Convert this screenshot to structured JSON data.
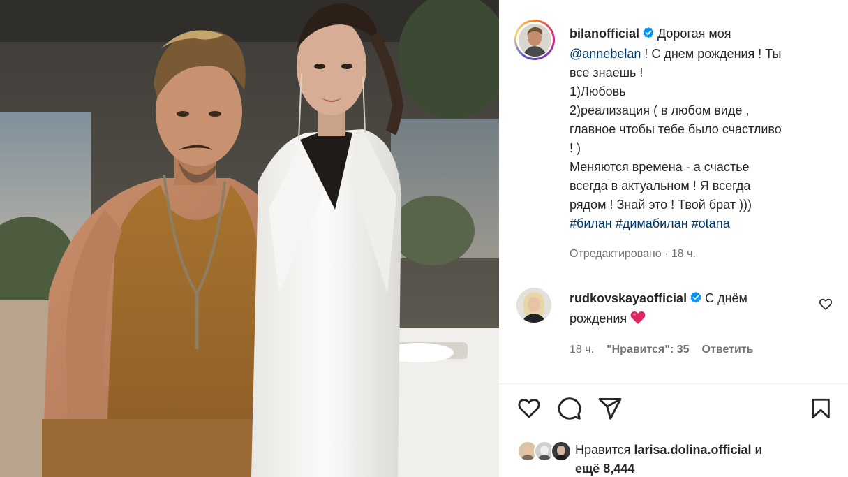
{
  "post": {
    "author": "bilanofficial",
    "caption_lines": [
      "Дорогая моя",
      "@annebelan",
      " ! С днем рождения ! Ты",
      "все знаешь !",
      "1)Любовь",
      "2)реализация ( в любом виде ,",
      "главное чтобы тебе было счастливо",
      "! )",
      "Меняются времена - а счастье",
      "всегда в актуальном ! Я всегда",
      "рядом ! Знай это ! Твой брат )))"
    ],
    "hashtags": [
      "#билан",
      "#димабилан",
      "#otana"
    ],
    "edited_label": "Отредактировано",
    "time": "18 ч."
  },
  "comment": {
    "author": "rudkovskayaofficial",
    "text_line1": "С днём",
    "text_line2": "рождения",
    "emoji": "❤️",
    "time": "18 ч.",
    "likes_label": "\"Нравится\": 35",
    "reply_label": "Ответить"
  },
  "likes": {
    "prefix": "Нравится",
    "user": "larisa.dolina.official",
    "suffix": "и",
    "rest": "ещё 8,444"
  },
  "icons": {
    "like": "heart-icon",
    "comment": "comment-icon",
    "share": "send-icon",
    "save": "bookmark-icon",
    "verified": "verified-badge-icon"
  },
  "colors": {
    "link": "#00376b",
    "verified": "#0095f6",
    "muted": "#737373",
    "heart_red": "#e0245e"
  }
}
